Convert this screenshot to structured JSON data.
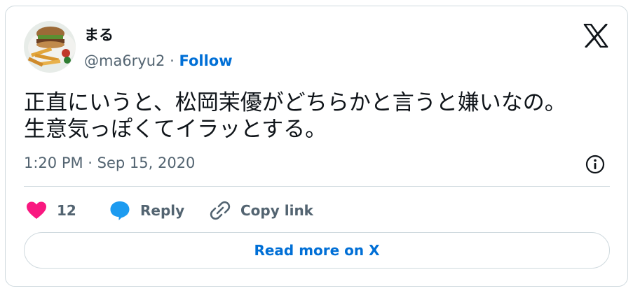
{
  "author": {
    "display_name": "まる",
    "handle": "@ma6ryu2",
    "separator": "·",
    "follow_label": "Follow"
  },
  "tweet": {
    "lines": [
      "正直にいうと、松岡茉優がどちらかと言うと嫌いなの。",
      "生意気っぽくてイラッとする。"
    ],
    "timestamp": "1:20 PM · Sep 15, 2020"
  },
  "actions": {
    "like_count": "12",
    "reply_label": "Reply",
    "copy_link_label": "Copy link"
  },
  "read_more_label": "Read more on X",
  "icons": {
    "logo": "x-logo-icon",
    "info": "info-icon",
    "like": "heart-icon",
    "reply": "speech-bubble-icon",
    "copy": "link-icon"
  },
  "colors": {
    "like": "#f91880",
    "reply": "#1d9bf0",
    "link": "#006fd6",
    "muted": "#536471",
    "border": "#cfd9de"
  }
}
